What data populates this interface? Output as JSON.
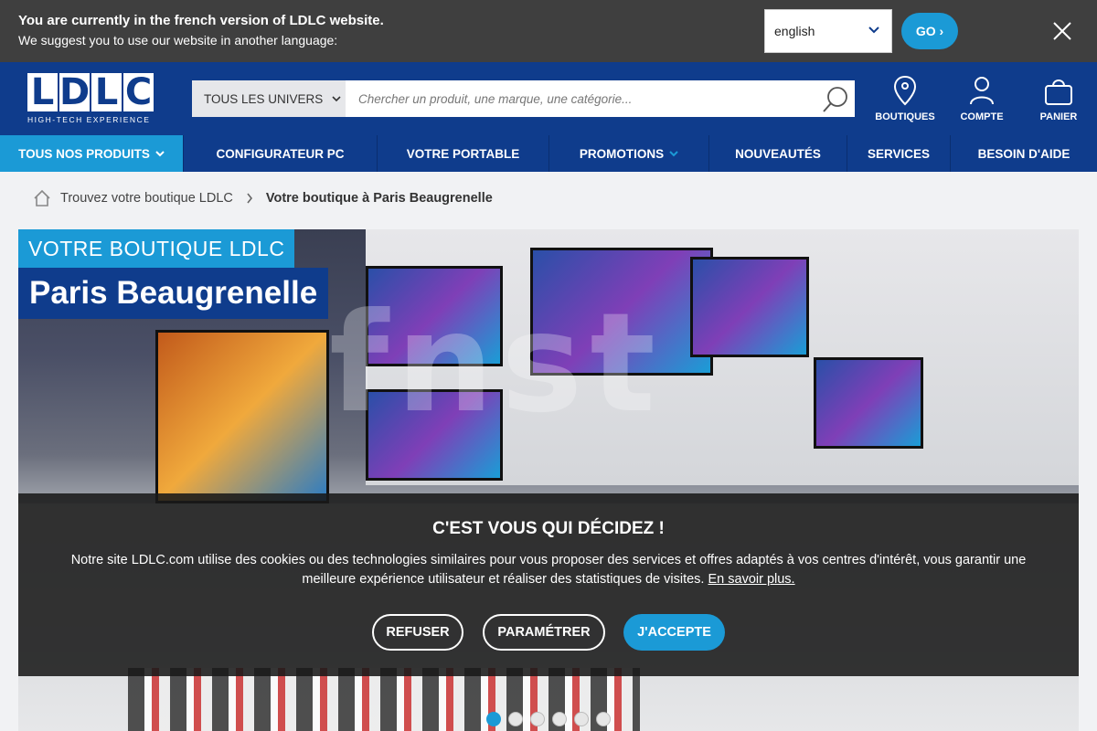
{
  "lang_bar": {
    "line1": "You are currently in the french version of LDLC website.",
    "line2": "We suggest you to use our website in another language:",
    "select_value": "english",
    "go_label": "GO ›"
  },
  "header": {
    "logo_letters": [
      "L",
      "D",
      "L",
      "C"
    ],
    "logo_tagline": "HIGH-TECH EXPERIENCE",
    "univers_label": "TOUS LES UNIVERS",
    "search_placeholder": "Chercher un produit, une marque, une catégorie...",
    "icons": {
      "boutiques": "BOUTIQUES",
      "compte": "COMPTE",
      "panier": "PANIER"
    }
  },
  "nav": {
    "items": [
      {
        "label": "TOUS NOS PRODUITS"
      },
      {
        "label": "CONFIGURATEUR PC"
      },
      {
        "label": "VOTRE PORTABLE"
      },
      {
        "label": "PROMOTIONS"
      },
      {
        "label": "NOUVEAUTÉS"
      },
      {
        "label": "SERVICES"
      },
      {
        "label": "BESOIN D'AIDE"
      }
    ]
  },
  "breadcrumb": {
    "parent": "Trouvez votre boutique LDLC",
    "current": "Votre boutique à Paris Beaugrenelle"
  },
  "hero": {
    "tag1": "VOTRE BOUTIQUE LDLC",
    "tag2": "Paris Beaugrenelle",
    "slides": 6,
    "active_slide": 1
  },
  "cookie": {
    "title": "C'EST VOUS QUI DÉCIDEZ !",
    "text": "Notre site LDLC.com utilise des cookies ou des technologies similaires pour vous proposer des services et offres adaptés à vos centres d'intérêt, vous garantir une meilleure expérience utilisateur et réaliser des statistiques de visites.",
    "link": "En savoir plus.",
    "refuse": "REFUSER",
    "settings": "PARAMÉTRER",
    "accept": "J'ACCEPTE"
  },
  "colors": {
    "brand_blue": "#0f3c8c",
    "accent_blue": "#1b9ad6",
    "lang_bar": "#3f3f3f"
  }
}
